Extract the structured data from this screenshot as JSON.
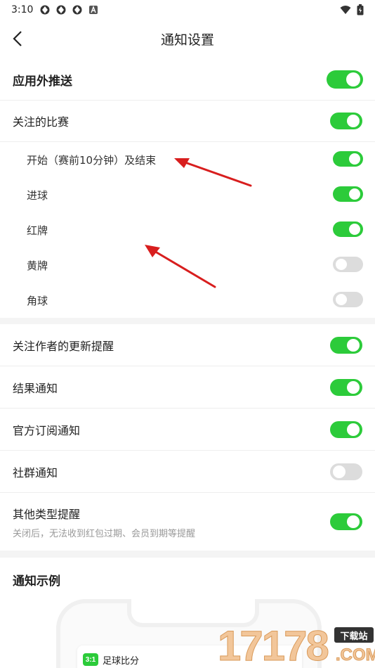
{
  "status_bar": {
    "time": "3:10",
    "icons": [
      "app-icon",
      "app-icon",
      "app-icon",
      "a-icon"
    ],
    "right_icons": [
      "wifi-icon",
      "battery-icon"
    ]
  },
  "nav": {
    "title": "通知设置",
    "back_icon": "chevron-left-icon"
  },
  "colors": {
    "toggle_on": "#2ccb3a",
    "toggle_off": "#dcdcdc",
    "arrow": "#d81e1e"
  },
  "settings": {
    "push": {
      "label": "应用外推送",
      "on": true
    },
    "followed_matches": {
      "label": "关注的比赛",
      "on": true
    },
    "sub_items": [
      {
        "label": "开始（赛前10分钟）及结束",
        "on": true
      },
      {
        "label": "进球",
        "on": true
      },
      {
        "label": "红牌",
        "on": true
      },
      {
        "label": "黄牌",
        "on": false
      },
      {
        "label": "角球",
        "on": false
      }
    ],
    "other_items": [
      {
        "label": "关注作者的更新提醒",
        "on": true
      },
      {
        "label": "结果通知",
        "on": true
      },
      {
        "label": "官方订阅通知",
        "on": true
      },
      {
        "label": "社群通知",
        "on": false
      },
      {
        "label": "其他类型提醒",
        "desc": "关闭后，无法收到红包过期、会员到期等提醒",
        "on": true
      }
    ]
  },
  "example": {
    "title": "通知示例",
    "app_logo_text": "3:1",
    "app_name": "足球比分"
  },
  "watermark": {
    "digits": "17178",
    "badge": "下载站",
    "suffix": ".COM"
  }
}
